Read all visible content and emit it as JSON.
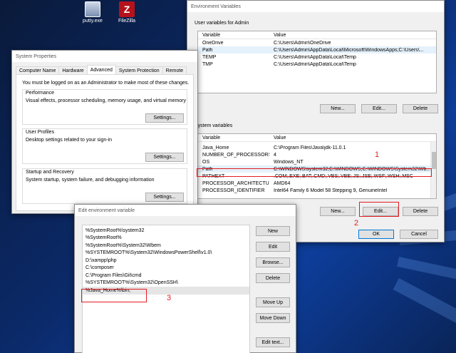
{
  "desktop": {
    "icons": [
      {
        "label": "putty.exe"
      },
      {
        "label": "FileZilla"
      }
    ]
  },
  "env_window": {
    "title": "Environment Variables",
    "user_group_title": "User variables for Admin",
    "col_variable": "Variable",
    "col_value": "Value",
    "user_vars": [
      {
        "name": "OneDrive",
        "value": "C:\\Users\\Admin\\OneDrive"
      },
      {
        "name": "Path",
        "value": "C:\\Users\\Admin\\AppData\\Local\\Microsoft\\WindowsApps;C:\\Users\\..."
      },
      {
        "name": "TEMP",
        "value": "C:\\Users\\Admin\\AppData\\Local\\Temp"
      },
      {
        "name": "TMP",
        "value": "C:\\Users\\Admin\\AppData\\Local\\Temp"
      }
    ],
    "user_buttons": {
      "new": "New...",
      "edit": "Edit...",
      "delete": "Delete"
    },
    "system_group_title": "System variables",
    "system_vars": [
      {
        "name": "Java_Home",
        "value": "C:\\Program Files\\Java\\jdk-11.0.1"
      },
      {
        "name": "NUMBER_OF_PROCESSORS",
        "value": "4"
      },
      {
        "name": "OS",
        "value": "Windows_NT"
      },
      {
        "name": "Path",
        "value": "C:\\WINDOWS\\system32;C:\\WINDOWS;C:\\WINDOWS\\System32\\Wb..."
      },
      {
        "name": "PATHEXT",
        "value": ".COM;.EXE;.BAT;.CMD;.VBS;.VBE;.JS;.JSE;.WSF;.WSH;.MSC"
      },
      {
        "name": "PROCESSOR_ARCHITECTURE",
        "value": "AMD64"
      },
      {
        "name": "PROCESSOR_IDENTIFIER",
        "value": "Intel64 Family 6 Model 58 Stepping 9, GenuineIntel"
      }
    ],
    "system_buttons": {
      "new": "New...",
      "edit": "Edit...",
      "delete": "Delete"
    },
    "ok": "OK",
    "cancel": "Cancel"
  },
  "sys_props": {
    "title": "System Properties",
    "tabs": [
      "Computer Name",
      "Hardware",
      "Advanced",
      "System Protection",
      "Remote"
    ],
    "active_tab": "Advanced",
    "admin_note": "You must be logged on as an Administrator to make most of these changes.",
    "performance": {
      "title": "Performance",
      "desc": "Visual effects, processor scheduling, memory usage, and virtual memory",
      "button": "Settings..."
    },
    "user_profiles": {
      "title": "User Profiles",
      "desc": "Desktop settings related to your sign-in",
      "button": "Settings..."
    },
    "startup": {
      "title": "Startup and Recovery",
      "desc": "System startup, system failure, and debugging information",
      "button": "Settings..."
    }
  },
  "edit_env": {
    "title": "Edit environment variable",
    "entries": [
      "%SystemRoot%\\system32",
      "%SystemRoot%",
      "%SystemRoot%\\System32\\Wbem",
      "%SYSTEMROOT%\\System32\\WindowsPowerShell\\v1.0\\",
      "D:\\xampp\\php",
      "C:\\composer",
      "C:\\Program Files\\Git\\cmd",
      "%SYSTEMROOT%\\System32\\OpenSSH\\",
      "%Java_Home%\\bin;"
    ],
    "buttons": {
      "new": "New",
      "edit": "Edit",
      "browse": "Browse...",
      "delete": "Delete",
      "move_up": "Move Up",
      "move_down": "Move Down",
      "edit_text": "Edit text..."
    }
  },
  "annotations": [
    "1",
    "2",
    "3"
  ],
  "colors": {
    "annotation": "#e31b23",
    "desktop_bg": "#0b2a6a",
    "selection": "#e5f1fb"
  }
}
